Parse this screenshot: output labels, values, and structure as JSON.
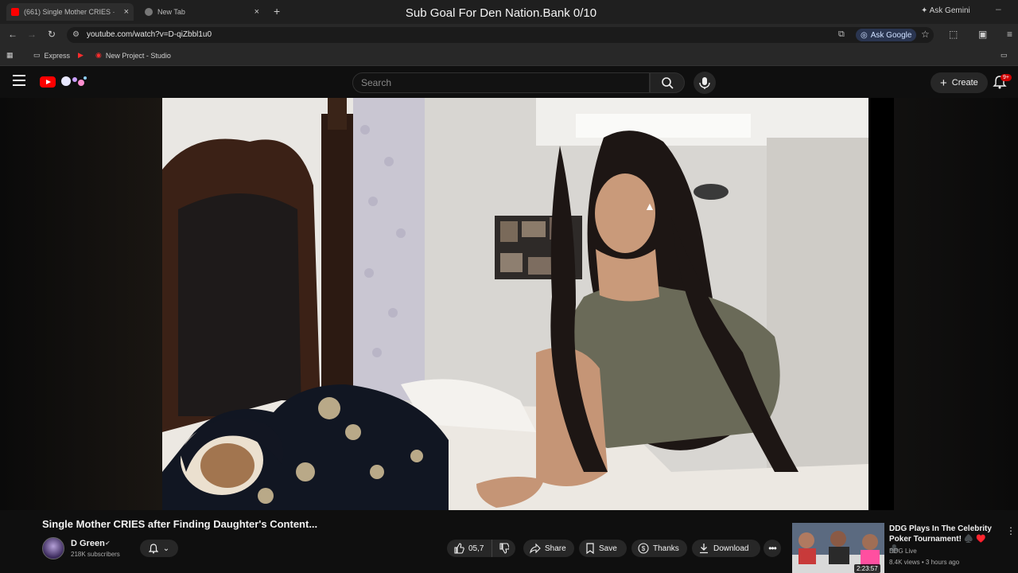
{
  "browser": {
    "tabs": [
      {
        "label": "(661) Single Mother CRIES ·",
        "active": true
      },
      {
        "label": "New Tab",
        "active": false
      }
    ],
    "stream_overlay_title": "Sub Goal For Den Nation.Bank 0/10",
    "ask_gemini": "Ask Gemini",
    "url": "youtube.com/watch?v=D-qiZbbl1u0",
    "ask_google": "Ask Google",
    "bookmarks": [
      "Express",
      "New Project - Studio"
    ]
  },
  "youtube": {
    "search_placeholder": "Search",
    "create_label": "Create",
    "notification_badge": "9+",
    "video": {
      "title": "Single Mother CRIES after Finding Daughter's Content...",
      "channel": "D Green",
      "subscribers": "218K subscribers",
      "like_count": "05,7",
      "share_label": "Share",
      "save_label": "Save",
      "thanks_label": "Thanks",
      "download_label": "Download"
    },
    "recommendation": {
      "title": "DDG Plays In The Celebrity Poker Tournament! ♠️ ♥️ ♣️",
      "channel": "DDG Live",
      "meta": "8.4K views • 3 hours ago",
      "duration": "2:23:57"
    }
  },
  "colors": {
    "accent": "#ff0000",
    "background": "#0f0f0f",
    "pill": "#272727"
  }
}
